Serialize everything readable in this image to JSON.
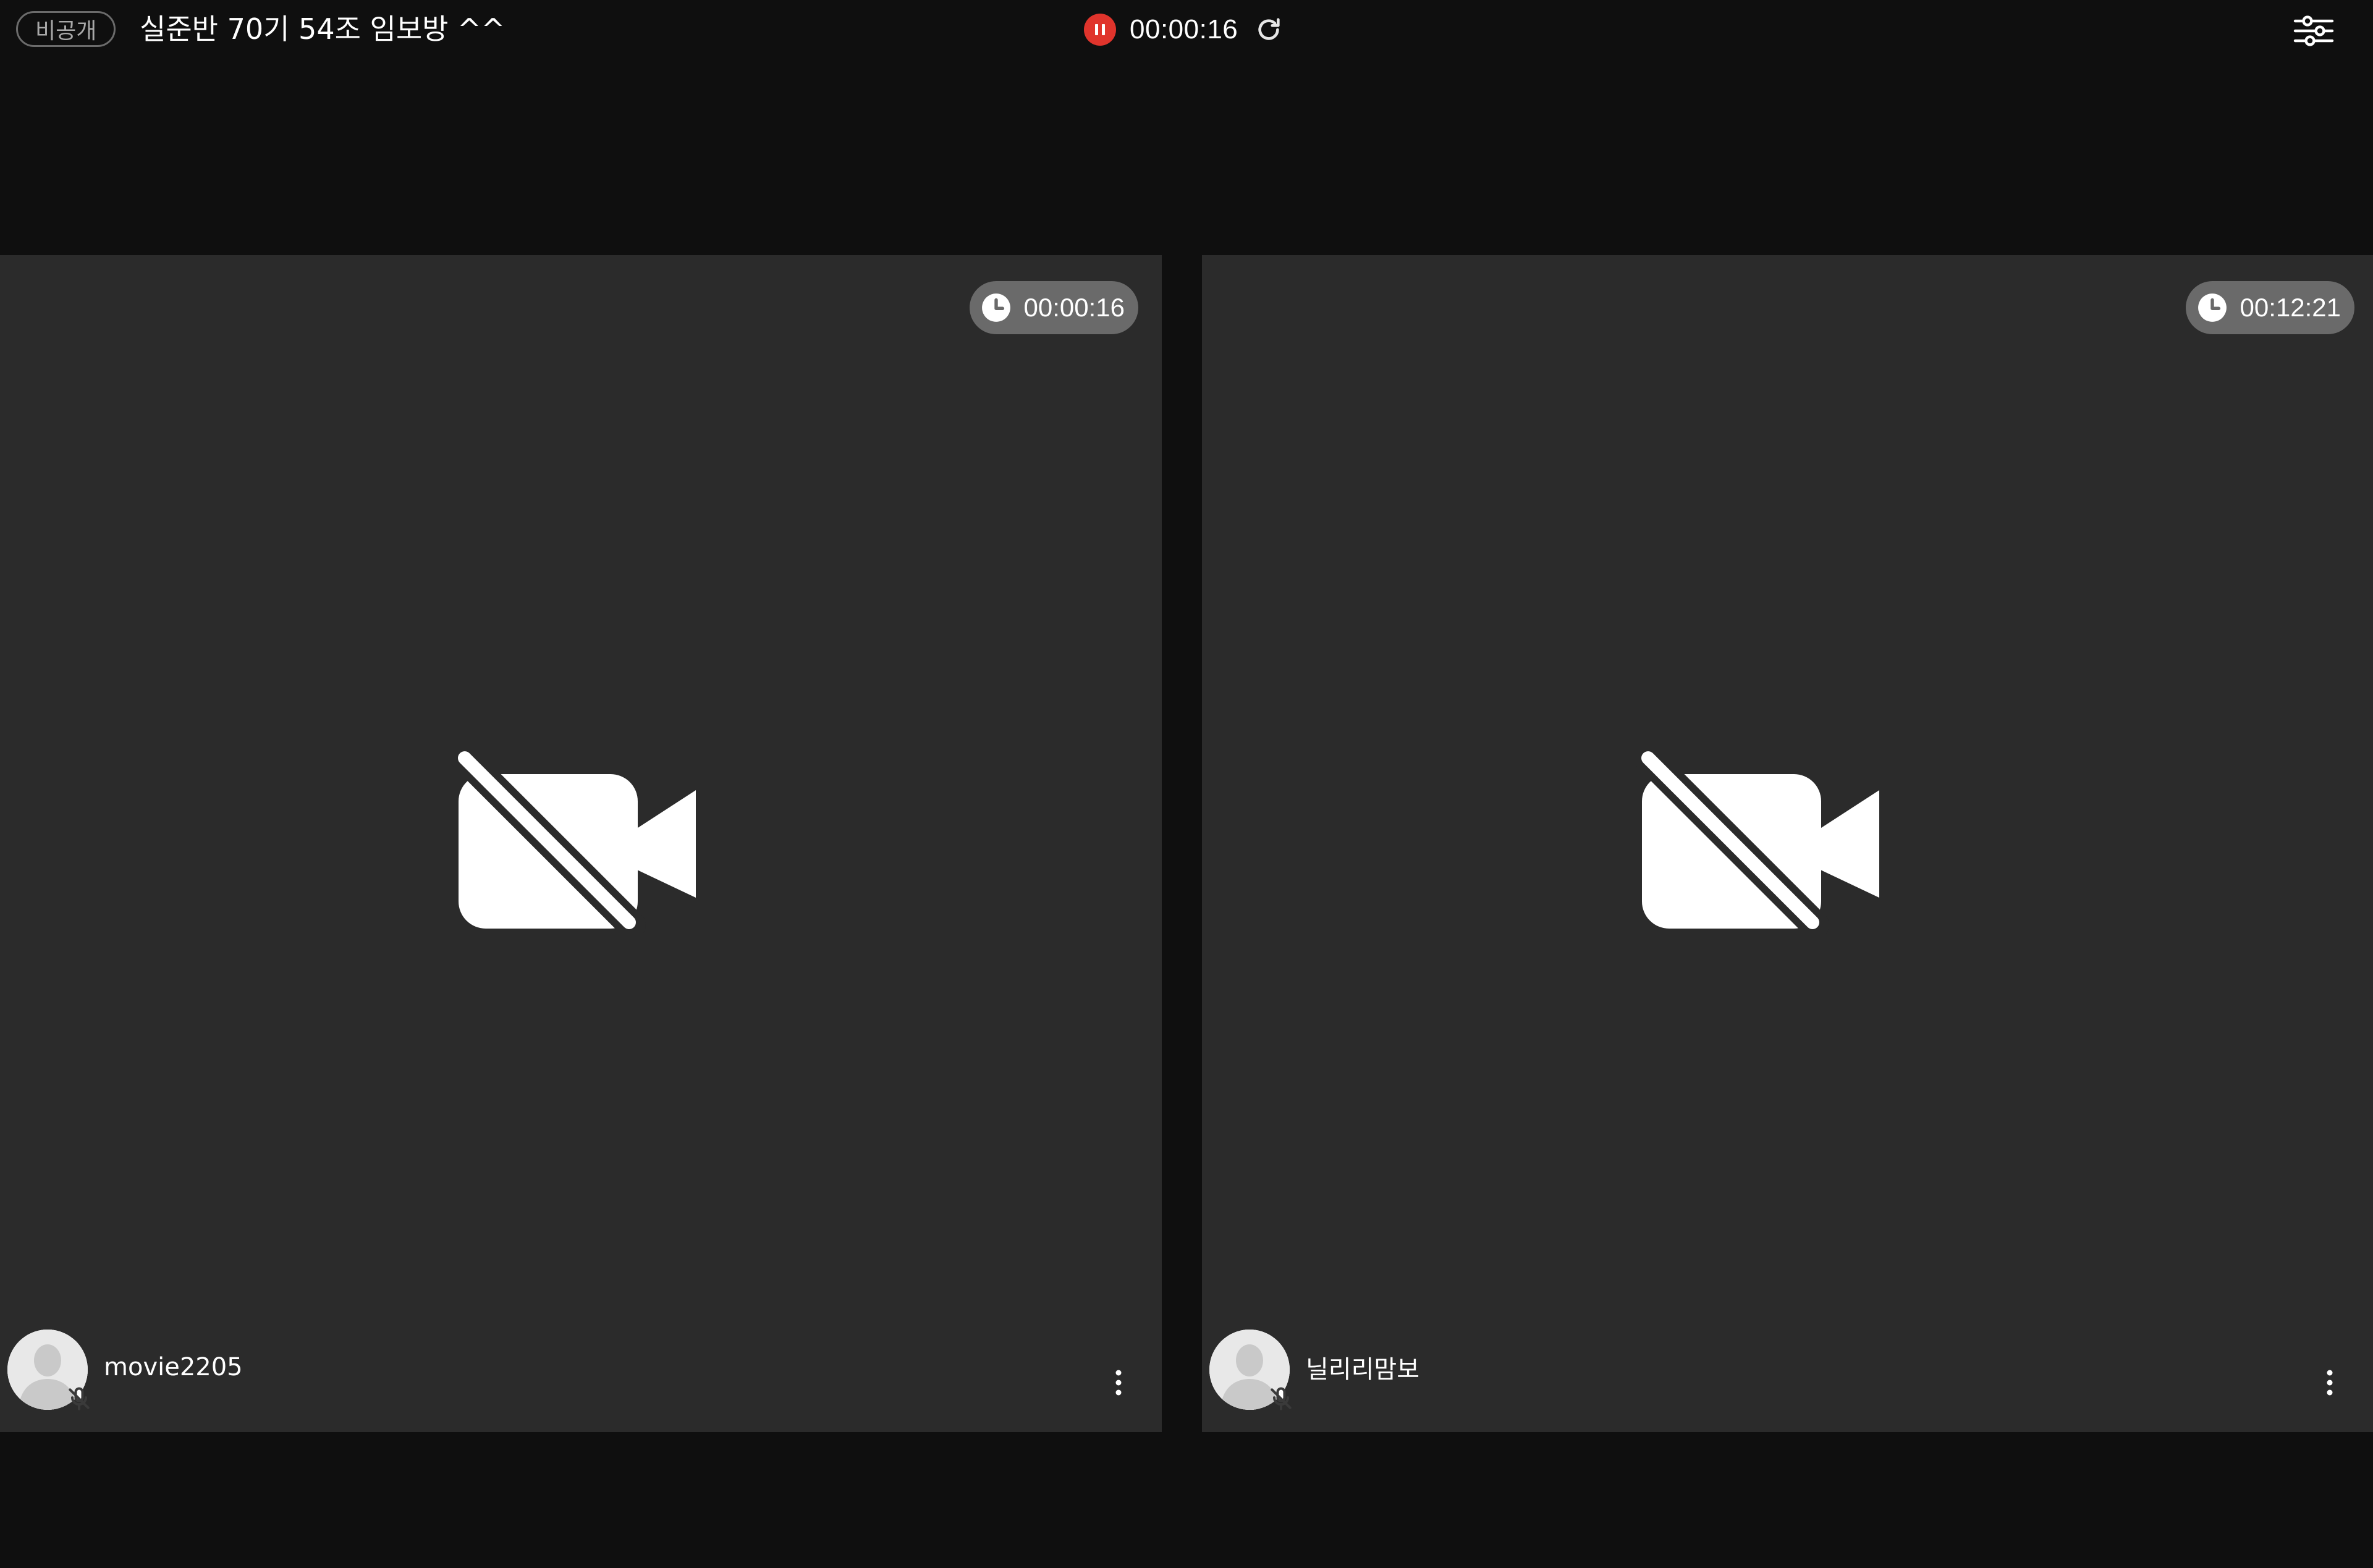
{
  "header": {
    "privacy_label": "비공개",
    "room_title": "실준반 70기 54조 임보방 ^^",
    "recording_time": "00:00:16",
    "record_icon": "pause-icon",
    "refresh_icon": "refresh-icon",
    "settings_icon": "sliders-icon"
  },
  "colors": {
    "background": "#0f0f0f",
    "tile": "#2b2b2b",
    "record": "#e0342c",
    "pill": "#6a6a6a"
  },
  "tiles": [
    {
      "timer": "00:00:16",
      "name": "movie2205",
      "camera_icon": "video-off-icon",
      "mic_icon": "mic-off-icon",
      "menu_icon": "more-vertical-icon"
    },
    {
      "timer": "00:12:21",
      "name": "닐리리맘보",
      "camera_icon": "video-off-icon",
      "mic_icon": "mic-off-icon",
      "menu_icon": "more-vertical-icon"
    }
  ]
}
